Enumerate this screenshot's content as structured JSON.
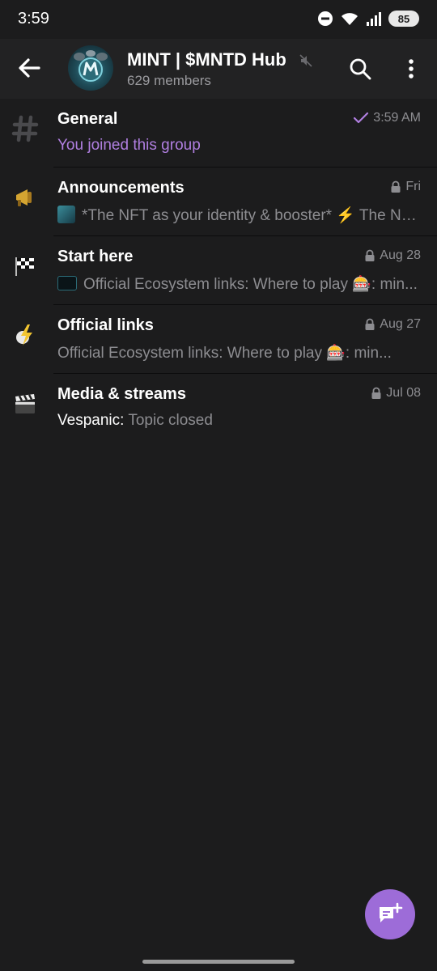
{
  "status_bar": {
    "time": "3:59",
    "battery": "85"
  },
  "header": {
    "title": "MINT | $MNTD Hub",
    "subtitle": "629 members"
  },
  "topics": [
    {
      "title": "General",
      "time": "3:59 AM",
      "message": "You joined this group",
      "icon": "hash-icon",
      "status": "read-check"
    },
    {
      "title": "Announcements",
      "time": "Fri",
      "message": "*The NFT as your identity & booster* ⚡ The NFT...",
      "icon": "megaphone-icon",
      "status": "lock"
    },
    {
      "title": "Start here",
      "time": "Aug 28",
      "message": "Official Ecosystem links:  Where to play 🎰: min...",
      "icon": "checkered-flag-icon",
      "status": "lock"
    },
    {
      "title": "Official links",
      "time": "Aug 27",
      "message": "Official Ecosystem links:  Where to play 🎰: min...",
      "icon": "lightning-icon",
      "status": "lock"
    },
    {
      "title": "Media & streams",
      "time": "Jul 08",
      "sender": "Vespanic:",
      "message": "Topic closed",
      "icon": "clapperboard-icon",
      "status": "lock"
    }
  ],
  "colors": {
    "accent": "#9d6cd8",
    "background": "#1c1c1d",
    "header": "#222223",
    "muted_text": "#8d8d91"
  }
}
